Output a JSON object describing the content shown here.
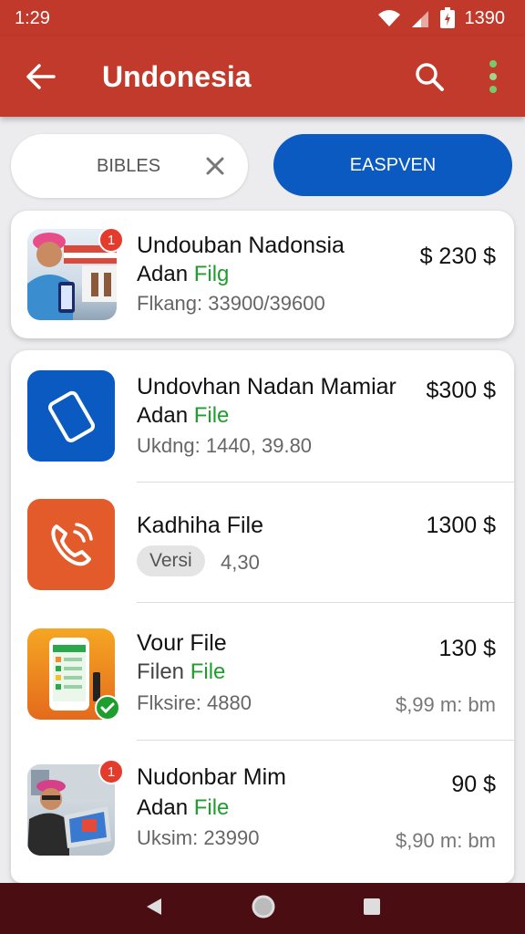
{
  "status": {
    "time": "1:29",
    "battery": "1390"
  },
  "appbar": {
    "title": "Undonesia"
  },
  "chips": {
    "left_label": "BIBLES",
    "right_label": "EASPVEN"
  },
  "items": [
    {
      "title": "Undouban Nadonsia",
      "subtitle_prefix": "Adan",
      "subtitle_accent": "Filg",
      "detail": "Flkang: 33900/39600",
      "price": "$ 230 $",
      "badge": "1"
    },
    {
      "title": "Undovhan Nadan Mamiar",
      "subtitle_prefix": "Adan",
      "subtitle_accent": "File",
      "detail": "Ukdng: 1440, 39.80",
      "price": "$300 $"
    },
    {
      "title": "Kadhiha File",
      "pill": "Versi",
      "detail": "4,30",
      "price": "1300 $"
    },
    {
      "title": "Vour File",
      "subtitle_prefix": "Filen",
      "subtitle_accent": "File",
      "detail": "Flksire: 4880",
      "price": "130 $",
      "meta": "$,99 m: bm"
    },
    {
      "title": "Nudonbar Mim",
      "subtitle_prefix": "Adan",
      "subtitle_accent": "File",
      "detail": "Uksim: 23990",
      "price": "90 $",
      "meta": "$,90 m: bm",
      "badge": "1"
    }
  ],
  "colors": {
    "appbar": "#c23a2c",
    "accent_blue": "#0a5ac2",
    "accent_green": "#1e9e2e",
    "badge_red": "#e53b2c",
    "navbar": "#4a0d12"
  },
  "icons": [
    "back-arrow-icon",
    "search-icon",
    "more-vert-icon",
    "close-icon",
    "phone-icon",
    "call-icon",
    "checkmark-icon",
    "nav-back-icon",
    "nav-home-icon",
    "nav-recents-icon"
  ]
}
